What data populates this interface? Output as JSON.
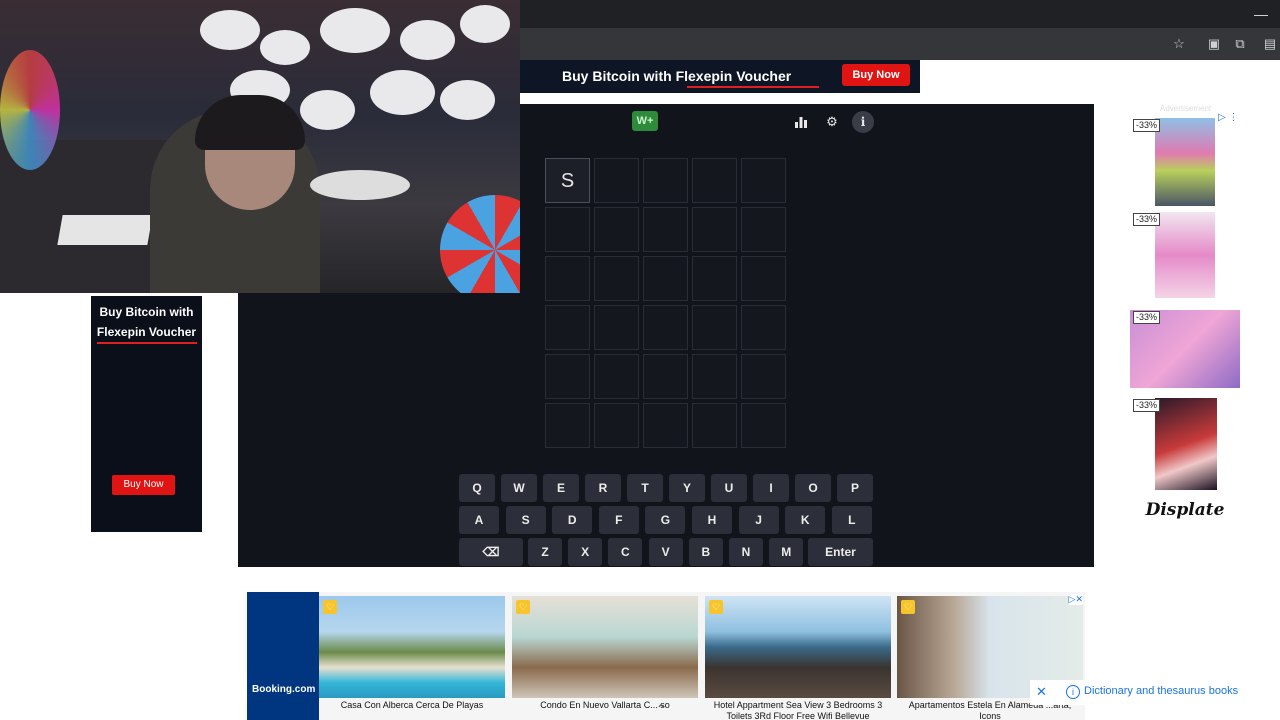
{
  "top_banner_ad": {
    "text_prefix": "Buy Bitcoin with ",
    "text_highlight": "Flexepin Voucher",
    "button": "Buy Now"
  },
  "left_ad": {
    "line1": "Buy Bitcoin with",
    "line2": "Flexepin Voucher",
    "button": "Buy Now"
  },
  "game": {
    "badge": "W+",
    "toolbar": {
      "stats_icon": "bar-chart-icon",
      "settings_icon": "gear-icon",
      "info_icon": "info-icon"
    },
    "grid": [
      [
        "S",
        "",
        "",
        "",
        ""
      ],
      [
        "",
        "",
        "",
        "",
        ""
      ],
      [
        "",
        "",
        "",
        "",
        ""
      ],
      [
        "",
        "",
        "",
        "",
        ""
      ],
      [
        "",
        "",
        "",
        "",
        ""
      ],
      [
        "",
        "",
        "",
        "",
        ""
      ]
    ],
    "keyboard": {
      "row1": [
        "Q",
        "W",
        "E",
        "R",
        "T",
        "Y",
        "U",
        "I",
        "O",
        "P"
      ],
      "row2": [
        "A",
        "S",
        "D",
        "F",
        "G",
        "H",
        "J",
        "K",
        "L"
      ],
      "row3": [
        "Z",
        "X",
        "C",
        "V",
        "B",
        "N",
        "M"
      ],
      "backspace_icon": "backspace-icon",
      "enter": "Enter"
    }
  },
  "right_ad": {
    "advertisement_label": "Advertisement",
    "tiles": [
      {
        "discount": "-33%"
      },
      {
        "discount": "-33%"
      },
      {
        "discount": "-33%"
      },
      {
        "discount": "-33%"
      }
    ],
    "brand": "Displate"
  },
  "bottom_ad": {
    "brand": "Booking.com",
    "hotels": [
      {
        "caption": "Casa Con Alberca Cerca De Playas"
      },
      {
        "caption": "Condo En Nuevo Vallarta C... so"
      },
      {
        "caption": "Hotel Appartment Sea View 3 Bedrooms 3 Toilets 3Rd Floor Free Wifi Bellevue"
      },
      {
        "caption": "Apartamentos Estela En Alameda ...arta, Icons"
      }
    ]
  },
  "dictionary_bar": {
    "text": "Dictionary and thesaurus books"
  },
  "colors": {
    "game_bg": "#12141c",
    "key_bg": "#2c2f39",
    "badge_green": "#2e8b3b",
    "ad_red": "#e11414",
    "booking_blue": "#003580"
  }
}
